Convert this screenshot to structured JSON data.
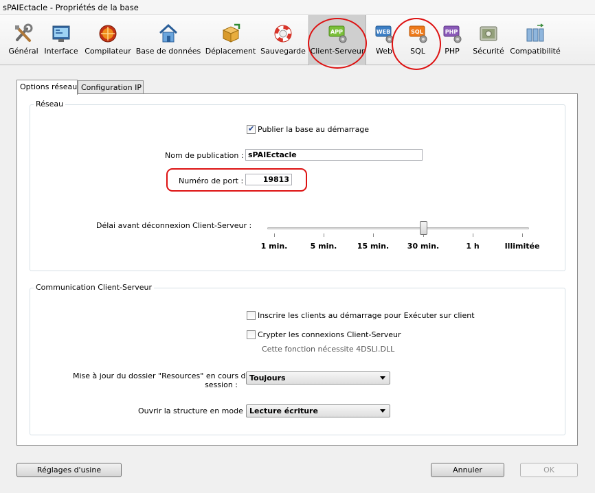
{
  "window": {
    "title": "sPAIEctacle - Propriétés de la base"
  },
  "toolbar": {
    "items": [
      {
        "label": "Général",
        "icon": "tools-icon"
      },
      {
        "label": "Interface",
        "icon": "interface-icon"
      },
      {
        "label": "Compilateur",
        "icon": "compiler-icon"
      },
      {
        "label": "Base de données",
        "icon": "database-house-icon"
      },
      {
        "label": "Déplacement",
        "icon": "move-box-icon"
      },
      {
        "label": "Sauvegarde",
        "icon": "lifebuoy-icon"
      },
      {
        "label": "Client-Serveur",
        "icon": "app-server-icon",
        "badge": "APP",
        "selected": true
      },
      {
        "label": "Web",
        "icon": "web-icon",
        "badge": "WEB"
      },
      {
        "label": "SQL",
        "icon": "sql-icon",
        "badge": "SQL"
      },
      {
        "label": "PHP",
        "icon": "php-icon",
        "badge": "PHP"
      },
      {
        "label": "Sécurité",
        "icon": "security-safe-icon"
      },
      {
        "label": "Compatibilité",
        "icon": "compatibility-icon"
      }
    ],
    "highlight_color": "#dd1111"
  },
  "tabs": [
    {
      "label": "Options réseau",
      "active": true
    },
    {
      "label": "Configuration IP",
      "active": false
    }
  ],
  "reseau": {
    "title": "Réseau",
    "publish_label": "Publier la base au démarrage",
    "publish_checked": true,
    "publication_name_label": "Nom de publication :",
    "publication_name_value": "sPAIEctacle",
    "port_label": "Numéro de port :",
    "port_value": "19813",
    "timeout_label": "Délai avant déconnexion Client-Serveur :",
    "timeout_ticks": [
      "1 min.",
      "5 min.",
      "15 min.",
      "30 min.",
      "1 h",
      "Illimitée"
    ],
    "timeout_selected": "30 min."
  },
  "communication": {
    "title": "Communication Client-Serveur",
    "register_label": "Inscrire les clients au démarrage pour Exécuter sur client",
    "register_checked": false,
    "encrypt_label": "Crypter les connexions Client-Serveur",
    "encrypt_checked": false,
    "encrypt_note": "Cette fonction nécessite 4DSLI.DLL",
    "resources_label_line1": "Mise à jour du dossier \"Resources\" en cours de",
    "resources_label_line2": "session :",
    "resources_value": "Toujours",
    "structure_label": "Ouvrir la structure en mode :",
    "structure_value": "Lecture écriture"
  },
  "footer": {
    "factory_label": "Réglages d'usine",
    "cancel_label": "Annuler",
    "ok_label": "OK"
  }
}
